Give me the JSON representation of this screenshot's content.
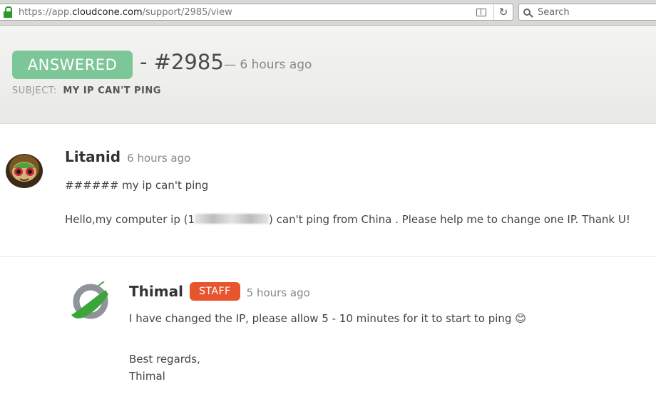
{
  "browser": {
    "url_prefix": "https://app.",
    "url_domain": "cloudcone.com",
    "url_path": "/support/2985/view",
    "search_placeholder": "Search"
  },
  "ticket": {
    "status": "ANSWERED",
    "number": "- #2985",
    "created_ago": "— 6 hours ago",
    "subject_label": "SUBJECT:",
    "subject": "MY IP CAN'T PING"
  },
  "messages": [
    {
      "author": "Litanid",
      "time": "6 hours ago",
      "heading": "###### my ip can't ping",
      "body_before": "Hello,my computer ip (1",
      "body_after": ") can't ping from China . Please help me to change one IP. Thank U!"
    },
    {
      "author": "Thimal",
      "badge": "STAFF",
      "time": "5 hours ago",
      "line1": "I have changed the IP, please allow 5 - 10 minutes for it to start to ping 😊",
      "signoff": "Best regards,",
      "signature": "Thimal"
    }
  ],
  "colors": {
    "answered": "#7dc698",
    "staff": "#e8552d"
  }
}
